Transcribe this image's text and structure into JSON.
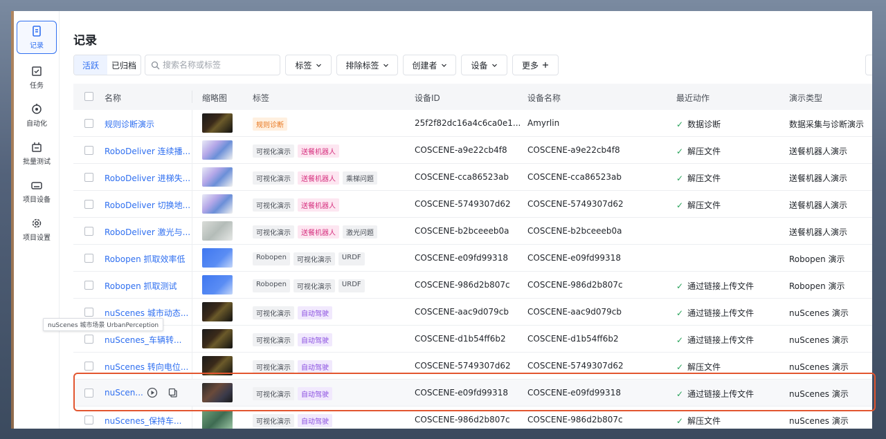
{
  "sidebar": {
    "items": [
      {
        "label": "记录",
        "icon": "document-icon",
        "active": true
      },
      {
        "label": "任务",
        "icon": "task-icon",
        "active": false
      },
      {
        "label": "自动化",
        "icon": "automation-icon",
        "active": false
      },
      {
        "label": "批量测试",
        "icon": "batch-test-icon",
        "active": false
      },
      {
        "label": "项目设备",
        "icon": "device-icon",
        "active": false
      },
      {
        "label": "项目设置",
        "icon": "gear-icon",
        "active": false
      }
    ]
  },
  "page": {
    "title": "记录"
  },
  "toolbar": {
    "tab_active": "活跃",
    "tab_archived": "已归档",
    "search_placeholder": "搜索名称或标签",
    "tags_filter": "标签",
    "exclude_tags": "排除标签",
    "creator": "创建者",
    "device": "设备",
    "more": "更多"
  },
  "table": {
    "headers": {
      "name": "名称",
      "thumbnail": "缩略图",
      "tags": "标签",
      "device_id": "设备ID",
      "device_name": "设备名称",
      "last_action": "最近动作",
      "demo_type": "演示类型"
    },
    "rows": [
      {
        "name": "规则诊断演示",
        "thumb": "dark",
        "tags": [
          {
            "text": "规则诊断",
            "tone": "orange"
          }
        ],
        "device_id": "25f2f82dc16a4c6ca0e1...",
        "device_name": "Amyrlin",
        "action": "数据诊断",
        "demo": "数据采集与诊断演示"
      },
      {
        "name": "RoboDeliver 连续播...",
        "thumb": "map",
        "tags": [
          {
            "text": "可视化演示",
            "tone": "gray"
          },
          {
            "text": "送餐机器人",
            "tone": "pink"
          }
        ],
        "device_id": "COSCENE-a9e22cb4f8",
        "device_name": "COSCENE-a9e22cb4f8",
        "action": "解压文件",
        "demo": "送餐机器人演示"
      },
      {
        "name": "RoboDeliver 进梯失...",
        "thumb": "map",
        "tags": [
          {
            "text": "可视化演示",
            "tone": "gray"
          },
          {
            "text": "送餐机器人",
            "tone": "pink"
          },
          {
            "text": "乘梯问题",
            "tone": "gray"
          }
        ],
        "device_id": "COSCENE-cca86523ab",
        "device_name": "COSCENE-cca86523ab",
        "action": "解压文件",
        "demo": "送餐机器人演示"
      },
      {
        "name": "RoboDeliver 切换地...",
        "thumb": "map",
        "tags": [
          {
            "text": "可视化演示",
            "tone": "gray"
          },
          {
            "text": "送餐机器人",
            "tone": "pink"
          }
        ],
        "device_id": "COSCENE-5749307d62",
        "device_name": "COSCENE-5749307d62",
        "action": "解压文件",
        "demo": "送餐机器人演示"
      },
      {
        "name": "RoboDeliver 激光与...",
        "thumb": "gray",
        "tags": [
          {
            "text": "可视化演示",
            "tone": "gray"
          },
          {
            "text": "送餐机器人",
            "tone": "pink"
          },
          {
            "text": "激光问题",
            "tone": "gray"
          }
        ],
        "device_id": "COSCENE-b2bceeeb0a",
        "device_name": "COSCENE-b2bceeeb0a",
        "action": "",
        "demo": "送餐机器人演示"
      },
      {
        "name": "Robopen 抓取效率低",
        "thumb": "blue",
        "tags": [
          {
            "text": "Robopen",
            "tone": "gray"
          },
          {
            "text": "可视化演示",
            "tone": "gray"
          },
          {
            "text": "URDF",
            "tone": "gray"
          }
        ],
        "device_id": "COSCENE-e09fd99318",
        "device_name": "COSCENE-e09fd99318",
        "action": "",
        "demo": "Robopen 演示"
      },
      {
        "name": "Robopen 抓取测试",
        "thumb": "blue",
        "tags": [
          {
            "text": "Robopen",
            "tone": "gray"
          },
          {
            "text": "可视化演示",
            "tone": "gray"
          },
          {
            "text": "URDF",
            "tone": "gray"
          }
        ],
        "device_id": "COSCENE-986d2b807c",
        "device_name": "COSCENE-986d2b807c",
        "action": "通过链接上传文件",
        "demo": "Robopen 演示"
      },
      {
        "name": "nuScenes 城市动态...",
        "thumb": "dark",
        "tags": [
          {
            "text": "可视化演示",
            "tone": "gray"
          },
          {
            "text": "自动驾驶",
            "tone": "purple"
          }
        ],
        "device_id": "COSCENE-aac9d079cb",
        "device_name": "COSCENE-aac9d079cb",
        "action": "通过链接上传文件",
        "demo": "nuScenes 演示"
      },
      {
        "name": "nuScenes_车辆转...",
        "thumb": "dark",
        "tags": [
          {
            "text": "可视化演示",
            "tone": "gray"
          },
          {
            "text": "自动驾驶",
            "tone": "purple"
          }
        ],
        "device_id": "COSCENE-d1b54ff6b2",
        "device_name": "COSCENE-d1b54ff6b2",
        "action": "通过链接上传文件",
        "demo": "nuScenes 演示"
      },
      {
        "name": "nuScenes 转向电位...",
        "thumb": "dark",
        "tags": [
          {
            "text": "可视化演示",
            "tone": "gray"
          },
          {
            "text": "自动驾驶",
            "tone": "purple"
          }
        ],
        "device_id": "COSCENE-5749307d62",
        "device_name": "COSCENE-5749307d62",
        "action": "解压文件",
        "demo": "nuScenes 演示"
      },
      {
        "name": "nuScen...",
        "thumb": "cam",
        "tags": [
          {
            "text": "可视化演示",
            "tone": "gray"
          },
          {
            "text": "自动驾驶",
            "tone": "purple"
          }
        ],
        "device_id": "COSCENE-e09fd99318",
        "device_name": "COSCENE-e09fd99318",
        "action": "通过链接上传文件",
        "demo": "nuScenes 演示",
        "selected": true
      },
      {
        "name": "nuScenes_保持车...",
        "thumb": "green",
        "tags": [
          {
            "text": "可视化演示",
            "tone": "gray"
          },
          {
            "text": "自动驾驶",
            "tone": "purple"
          }
        ],
        "device_id": "COSCENE-986d2b807c",
        "device_name": "COSCENE-986d2b807c",
        "action": "解压文件",
        "demo": "nuScenes 演示"
      }
    ]
  },
  "tooltip": {
    "text": "nuScenes 城市场景 UrbanPerception"
  },
  "colors": {
    "accent": "#2f6ff0",
    "success": "#27a259",
    "highlight_border": "#e2552f"
  }
}
